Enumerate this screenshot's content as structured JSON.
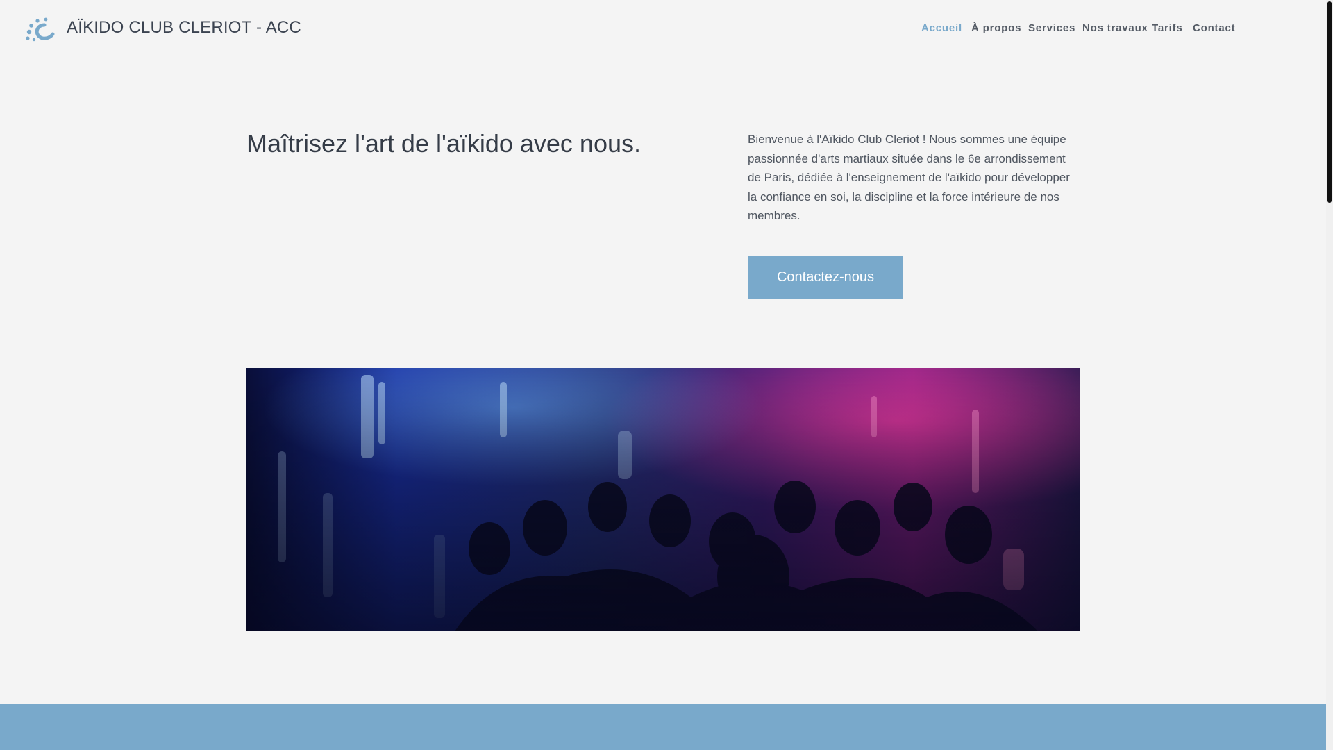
{
  "header": {
    "brand": "AÏKIDO CLUB CLERIOT - ACC",
    "logo_icon": "splash-logo-icon",
    "nav": {
      "home": "Accueil",
      "about": "À propos",
      "services": "Services",
      "works": "Nos travaux",
      "pricing": "Tarifs",
      "contact": "Contact"
    }
  },
  "hero": {
    "title": "Maîtrisez l'art de l'aïkido avec nous.",
    "description": "Bienvenue à l'Aïkido Club Cleriot ! Nous sommes une équipe passionnée d'arts martiaux située dans le 6e arrondissement de Paris, dédiée à l'enseignement de l'aïkido pour développer la confiance en soi, la discipline et la force intérieure de nos membres.",
    "cta_label": "Contactez-nous"
  },
  "banner": {
    "image": "blurred-crowd-photo"
  },
  "colors": {
    "accent": "#79a9cb",
    "background": "#f4f4f4",
    "text_dark": "#353c47",
    "text_body": "#4f5660"
  }
}
